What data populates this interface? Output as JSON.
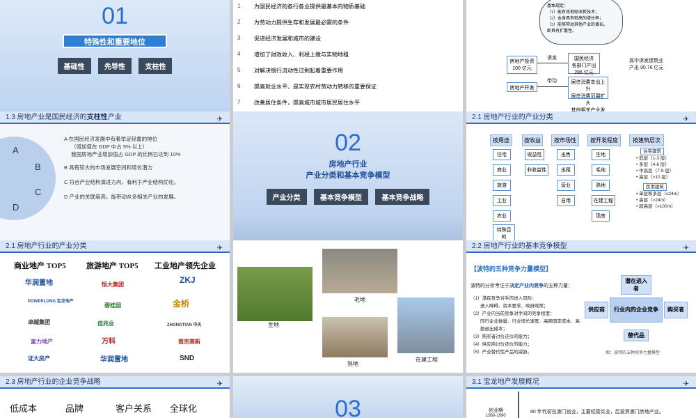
{
  "s1": {
    "num": "01",
    "title": "特殊性和重要地位",
    "tags": [
      "基础性",
      "先导性",
      "支柱性"
    ]
  },
  "s2": {
    "items": [
      {
        "n": "1",
        "t": "为国民经济的各行各业提供最基本的物质基础"
      },
      {
        "n": "2",
        "t": "为劳动力提供生存和发展最必需的条件"
      },
      {
        "n": "3",
        "t": "促进经济发展和城市的建设"
      },
      {
        "n": "4",
        "t": "增加了财政收入、利税上缴与实物地租"
      },
      {
        "n": "5",
        "t": "对解决银行流动性过剩起着重要作用"
      },
      {
        "n": "6",
        "t": "提高就业水平、是实现农村劳动力转移的重要保证"
      },
      {
        "n": "7",
        "t": "改善居住条件，提高城市城市居民居住水平"
      }
    ]
  },
  "s3": {
    "cloud": [
      "基本规定：",
      "（1）能有效地吸收新技术；",
      "（2）本身具有较高的增长率；",
      "（3）能够带动其他产业的增长。",
      "即具有扩散性。"
    ],
    "invest": "房地产投资",
    "invest_amt": "100 亿元",
    "induce": "诱发",
    "gdp": "国民经济",
    "gdp2": "各部门产出",
    "gdp3": "286 亿元",
    "construct": "其中诱发建筑业",
    "construct2": "产出 90.76 亿元",
    "dev": "房地产开发",
    "drive": "带动",
    "consume": "居住消费支出上升",
    "consume2": "居住消费范围扩大",
    "consume3": "其他相关产业发展"
  },
  "s4": {
    "header": "1.3  房地产业是国民经济的",
    "header_b": "支柱性",
    "header_e": "产业",
    "letters": [
      "A",
      "B",
      "C",
      "D"
    ],
    "lines": [
      "A  在国民经济发展中有着举足轻重的地位",
      "（增加值在 GDP 中占 5% 以上）",
      "我国房地产业增加值占 GDP 的比例已达到 10%",
      "B  具有较大的市场发展空间和增长潜力",
      "C  符合产业结构演进方向，有利于产业结构优化。",
      "D  产业的关联度高，能带动众多相关产业的发展。"
    ]
  },
  "s5": {
    "num": "02",
    "title1": "房地产行业",
    "title2": "产业分类和基本竞争模型",
    "tags": [
      "产业分类",
      "基本竞争模型",
      "基本竞争战略"
    ]
  },
  "s6": {
    "header": "2.1  房地产行业的产业分类",
    "cols": [
      {
        "h": "按用途",
        "items": [
          "住宅",
          "商业",
          "旅游",
          "工业",
          "农业",
          "特殊目的"
        ]
      },
      {
        "h": "按收益",
        "items": [
          "收益性",
          "非收益性"
        ]
      },
      {
        "h": "按市场性",
        "items": [
          "出售",
          "出租",
          "营业",
          "自用"
        ]
      },
      {
        "h": "按开发程度",
        "items": [
          "生地",
          "毛地",
          "熟地",
          "在建工程",
          "现房"
        ]
      },
      {
        "h": "按建筑层次",
        "items": [
          "住宅建筑",
          "• 低层（1-3 层）",
          "• 多层（4-6 层）",
          "• 中高层（7-9 层）",
          "• 高层（>10 层）",
          "民用建筑",
          "• 单层和多层（≤24m）",
          "• 高层（>24m）",
          "• 超高层（>100m）"
        ]
      }
    ]
  },
  "s7": {
    "header": "2.1  房地产行业的产业分类",
    "cats": [
      "商业地产 TOP5",
      "旅游地产 TOP5",
      "工业地产领先企业"
    ],
    "logos": [
      "华润置地",
      "恒大集团",
      "ZKJ",
      "POWERLONG 宝龙地产",
      "碧桂园",
      "金桥",
      "卓越集团",
      "佳兆业",
      "ZHONGTIAN 中天",
      "富力地产",
      "万科",
      "南京高新",
      "证大房产",
      "华润置地",
      "SND"
    ]
  },
  "s8": {
    "labels": [
      "生地",
      "毛地",
      "熟地",
      "在建工程"
    ]
  },
  "s9": {
    "header": "2.2  房地产行业的基本竞争模型",
    "model": "【波特的五种竞争力量模型】",
    "intro_a": "波特的分析考注于",
    "intro_b": "决定产业内竞争",
    "intro_c": "的五种力量：",
    "items": [
      "（1）潜在竞争对手的进入风险：",
      "进入障碍、资本要求、政府政策；",
      "（2）产业内当前竞争对手间的竞争程度：",
      "同行企业数量、行业增长速度、高额固定成本、高额退出成本；",
      "（3）购买者讨价还价的能力；",
      "（4）供应商讨价还价的能力；",
      "（5）产业替代性产品的威胁。"
    ],
    "diagram": {
      "top": "潜在进入者",
      "left": "供应商",
      "center": "行业内的企业竞争",
      "right": "购买者",
      "bottom": "替代品",
      "caption": "图：波特的五种竞争力量模型"
    }
  },
  "s10": {
    "header": "2.3  房地产行业的企业竞争战略",
    "words": [
      "低成本",
      "品牌",
      "客户关系",
      "全球化"
    ]
  },
  "s11": {
    "num": "03"
  },
  "s12": {
    "header": "3.1  宝龙地产发展概况",
    "phase": "创业期",
    "years": "1980-1990",
    "desc": "80 年代初在澳门创业，主要经营实业，后投资澳门房地产业。"
  }
}
